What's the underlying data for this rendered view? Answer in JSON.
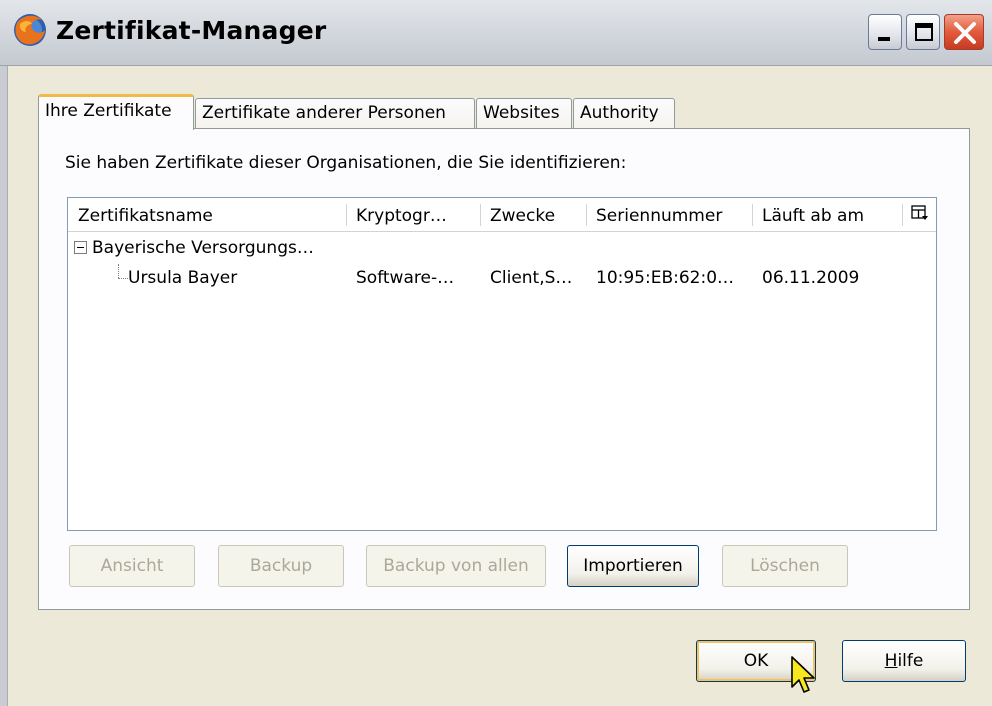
{
  "window": {
    "title": "Zertifikat-Manager",
    "icon": "firefox-icon"
  },
  "tabs": [
    {
      "label": "Ihre Zertifikate",
      "active": true
    },
    {
      "label": "Zertifikate anderer Personen",
      "active": false
    },
    {
      "label": "Websites",
      "active": false
    },
    {
      "label": "Authority",
      "active": false
    }
  ],
  "panel": {
    "intro": "Sie haben Zertifikate dieser Organisationen, die Sie identifizieren:"
  },
  "tree": {
    "columns": [
      "Zertifikatsname",
      "Kryptogr…",
      "Zwecke",
      "Seriennummer",
      "Läuft ab am"
    ],
    "group": {
      "name": "Bayerische Versorgungs…",
      "expanded": true
    },
    "rows": [
      {
        "name": "Ursula Bayer",
        "crypto": "Software-…",
        "purposes": "Client,S…",
        "serial": "10:95:EB:62:0…",
        "expires": "06.11.2009"
      }
    ]
  },
  "actions": {
    "view": "Ansicht",
    "backup": "Backup",
    "backup_all": "Backup von allen",
    "import": "Importieren",
    "delete": "Löschen"
  },
  "footer": {
    "ok": "OK",
    "help_mnemonic": "H",
    "help_rest": "ilfe"
  },
  "colors": {
    "dialog_bg": "#ece9d8",
    "tab_active_accent": "#f2b84b",
    "default_button_glow": "#f8c157",
    "close_button": "#e25a3c"
  }
}
